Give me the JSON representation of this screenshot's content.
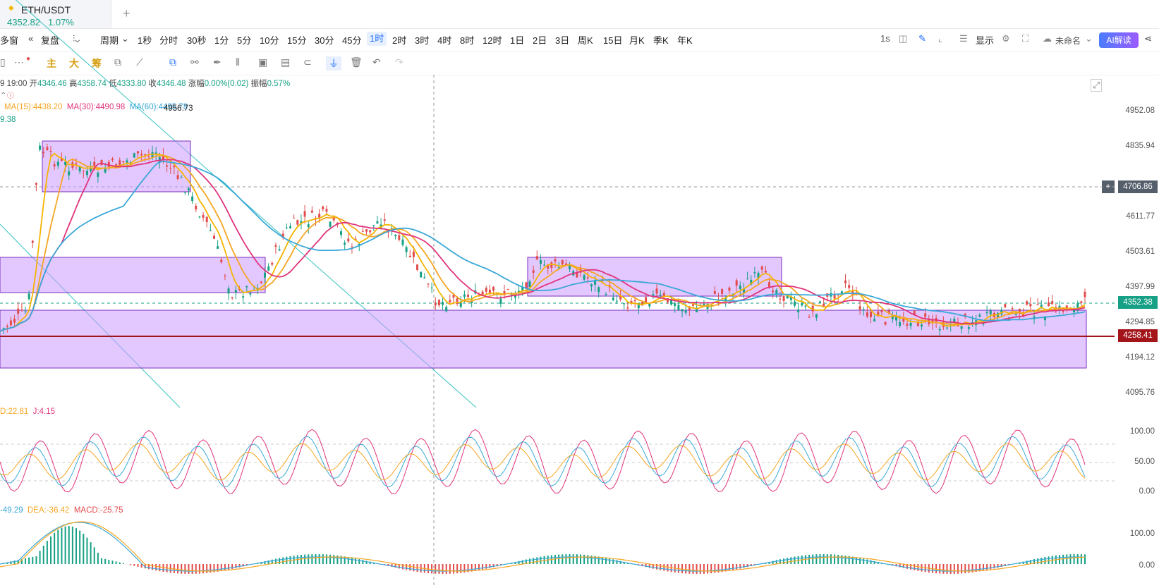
{
  "tab": {
    "title": "ETH/USDT",
    "price": "4352.82",
    "change": "1.07%",
    "add": "+"
  },
  "toolbar": {
    "items": [
      "多窗",
      "复盘",
      "周期",
      "1秒",
      "分时",
      "30秒",
      "1分",
      "5分",
      "10分",
      "15分",
      "30分",
      "45分",
      "1时",
      "2时",
      "3时",
      "4时",
      "8时",
      "12时",
      "1日",
      "2日",
      "3日",
      "周K",
      "15日",
      "月K",
      "季K",
      "年K"
    ],
    "active": "1时",
    "right": {
      "interval": "1s",
      "display": "显示",
      "layout": "未命名",
      "ai": "AI解读"
    }
  },
  "toolbar2": {
    "indicators": [
      "主",
      "大",
      "筹"
    ]
  },
  "ohlc": {
    "time": "9 19:00",
    "open_label": "开",
    "open": "4346.46",
    "high_label": "高",
    "high": "4358.74",
    "low_label": "低",
    "low": "4333.80",
    "close_label": "收",
    "close": "4346.48",
    "chg_label": "涨幅",
    "chg": "0.00%(0.02)",
    "amp_label": "振幅",
    "amp": "0.57%"
  },
  "ma": {
    "ma15": "MA(15):4438.20",
    "ma30": "MA(30):4490.98",
    "ma60": "MA(60):4495.78",
    "ma_left": "9.38",
    "high_marker": "4956.73"
  },
  "kdj": {
    "d": "D:22.81",
    "j": "J:4.15"
  },
  "macd": {
    "dif": "-49.29",
    "dea": "DEA:-36.42",
    "macd": "MACD:-25.75"
  },
  "price_axis": [
    "4952.08",
    "4835.94",
    "4611.77",
    "4503.61",
    "4397.99",
    "4294.85",
    "4194.12",
    "4095.76"
  ],
  "tags": {
    "crosshair": "4706.86",
    "current": "4352.38",
    "support": "4258.41"
  },
  "kdj_axis": [
    "100.00",
    "50.00",
    "0.00"
  ],
  "macd_axis": [
    "100.00",
    "0.00"
  ],
  "colors": {
    "up": "#16a085",
    "down": "#e24c4c",
    "ma5": "#f5b400",
    "ma15": "#f5a623",
    "ma30": "#e0347c",
    "ma60": "#3aa8d8",
    "box": "#cc99ff"
  }
}
